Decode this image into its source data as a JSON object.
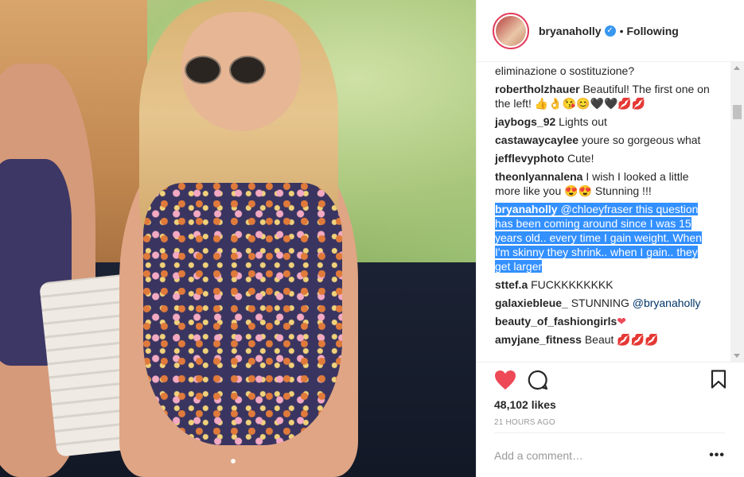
{
  "post": {
    "username": "bryanaholly",
    "verified_badge": "verified-badge-icon",
    "separator": "•",
    "follow_label": "Following"
  },
  "comments": [
    {
      "user": "",
      "text": "eliminazione o sostituzione?"
    },
    {
      "user": "robertholzhauer",
      "text": "Beautiful! The first one on the left! 👍👌😘😊🖤🖤💋💋"
    },
    {
      "user": "jaybogs_92",
      "text": "Lights out"
    },
    {
      "user": "castawaycaylee",
      "text": "youre so gorgeous what"
    },
    {
      "user": "jefflevyphoto",
      "text": "Cute!"
    },
    {
      "user": "theonlyannalena",
      "text": "I wish I looked a little more like you 😍😍 Stunning !!!"
    },
    {
      "user": "bryanaholly",
      "mention": "@chloeyfraser",
      "text": "this question has been coming around since I was 15 years old.. every time I gain weight. When I'm skinny they shrink.. when I gain.. they get larger"
    },
    {
      "user": "sttef.a",
      "text": "FUCKKKKKKKK"
    },
    {
      "user": "galaxiebleue_",
      "text": "STUNNING",
      "mention": "@bryanaholly"
    },
    {
      "user": "beauty_of_fashiongirls",
      "text": "❤"
    },
    {
      "user": "amyjane_fitness",
      "text": "Beaut 💋💋💋"
    }
  ],
  "footer": {
    "likes": "48,102 likes",
    "time": "21 HOURS AGO",
    "comment_placeholder": "Add a comment…",
    "more_label": "•••"
  },
  "colors": {
    "like_red": "#ed4956",
    "verified_blue": "#3897f0",
    "selection_blue": "#3390ff"
  }
}
